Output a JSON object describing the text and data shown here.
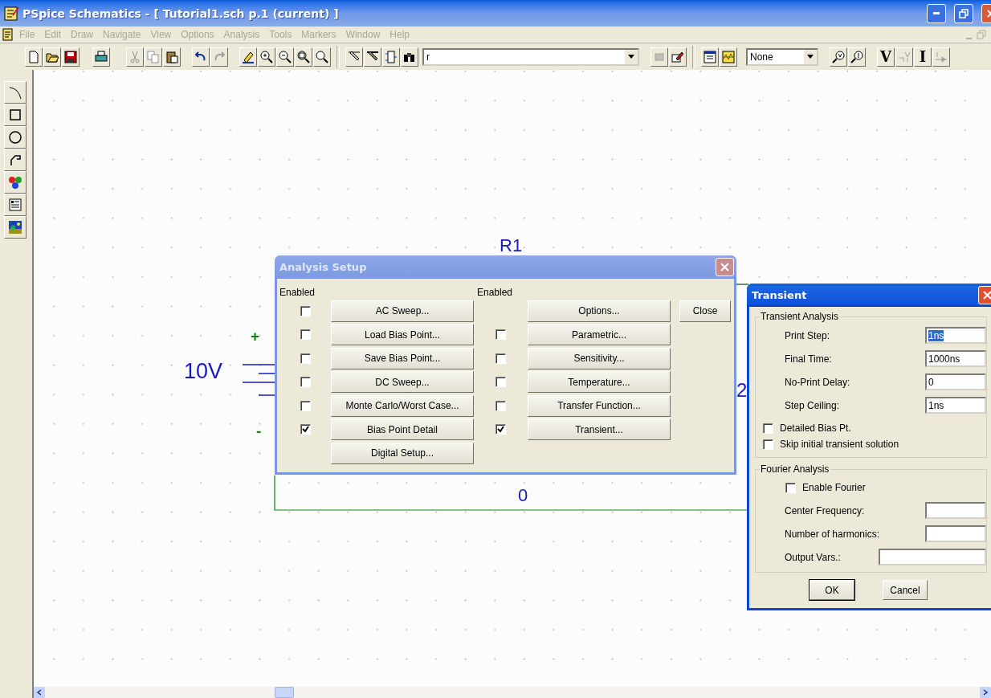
{
  "window": {
    "title": "PSpice Schematics - [ Tutorial1.sch  p.1 (current) ]"
  },
  "menu": [
    {
      "label": "File",
      "disabled": true
    },
    {
      "label": "Edit",
      "disabled": true
    },
    {
      "label": "Draw",
      "disabled": true
    },
    {
      "label": "Navigate",
      "disabled": true
    },
    {
      "label": "View",
      "disabled": true
    },
    {
      "label": "Options",
      "disabled": true
    },
    {
      "label": "Analysis",
      "disabled": true
    },
    {
      "label": "Tools",
      "disabled": true
    },
    {
      "label": "Markers",
      "disabled": true
    },
    {
      "label": "Window",
      "disabled": true
    },
    {
      "label": "Help",
      "disabled": true
    }
  ],
  "toolbar": {
    "part_combo": {
      "value": "r"
    },
    "marker_combo": {
      "value": "None"
    },
    "text_buttons": [
      {
        "label": "V",
        "disabled": false
      },
      {
        "label": "I",
        "disabled": false
      }
    ]
  },
  "schematic": {
    "labels": [
      {
        "text": "R1",
        "kind": "part_reference"
      },
      {
        "text": "10V",
        "kind": "source_value"
      },
      {
        "text": "+",
        "kind": "plus_terminal"
      },
      {
        "text": "-",
        "kind": "minus_terminal"
      },
      {
        "text": "0",
        "kind": "ground_node"
      },
      {
        "text": "2",
        "kind": "pin_number"
      }
    ]
  },
  "analysis_setup": {
    "title": "Analysis Setup",
    "left_heading": "Enabled",
    "right_heading": "Enabled",
    "close": "Close",
    "left": [
      {
        "label": "AC Sweep...",
        "checked": false
      },
      {
        "label": "Load Bias Point...",
        "checked": false
      },
      {
        "label": "Save Bias Point...",
        "checked": false
      },
      {
        "label": "DC Sweep...",
        "checked": false
      },
      {
        "label": "Monte Carlo/Worst Case...",
        "checked": false
      },
      {
        "label": "Bias Point Detail",
        "checked": true
      },
      {
        "label": "Digital Setup..."
      }
    ],
    "right": [
      {
        "label": "Options..."
      },
      {
        "label": "Parametric...",
        "checked": false
      },
      {
        "label": "Sensitivity...",
        "checked": false
      },
      {
        "label": "Temperature...",
        "checked": false
      },
      {
        "label": "Transfer Function...",
        "checked": false
      },
      {
        "label": "Transient...",
        "checked": true
      }
    ]
  },
  "transient": {
    "title": "Transient",
    "transient_group": {
      "legend": "Transient Analysis",
      "fields": [
        {
          "label": "Print Step:",
          "value": "1ns",
          "selected": true
        },
        {
          "label": "Final Time:",
          "value": "1000ns",
          "selected": false
        },
        {
          "label": "No-Print Delay:",
          "value": "0",
          "selected": false
        },
        {
          "label": "Step Ceiling:",
          "value": "1ns",
          "selected": false
        }
      ],
      "options": [
        {
          "label": "Detailed Bias Pt.",
          "checked": false
        },
        {
          "label": "Skip initial transient solution",
          "checked": false
        }
      ]
    },
    "fourier_group": {
      "legend": "Fourier Analysis",
      "enable": {
        "label": "Enable Fourier",
        "checked": false
      },
      "fields": [
        {
          "label": "Center Frequency:",
          "kind": "normal"
        },
        {
          "label": "Number of harmonics:",
          "kind": "normal"
        },
        {
          "label": "Output Vars.:",
          "kind": "wide"
        }
      ]
    },
    "buttons": [
      {
        "label": "OK",
        "default": true
      },
      {
        "label": "Cancel",
        "default": false
      }
    ]
  }
}
